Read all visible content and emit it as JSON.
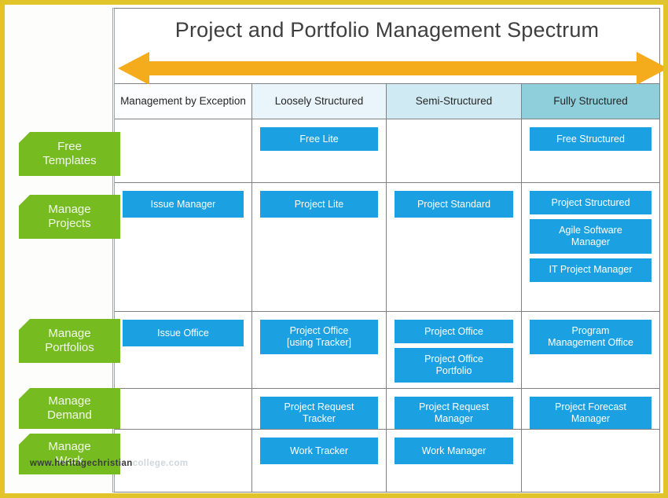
{
  "frame": {
    "border_color": "#e0c429"
  },
  "header": {
    "title": "Project and Portfolio Management Spectrum",
    "arrow": {
      "name": "double-headed-arrow",
      "color": "#f5ac1c",
      "direction": "both"
    }
  },
  "columns": [
    {
      "label": "Management by\nException",
      "bg": "#fbfdfe"
    },
    {
      "label": "Loosely Structured",
      "bg": "#e9f5fa"
    },
    {
      "label": "Semi-Structured",
      "bg": "#cfeaf2"
    },
    {
      "label": "Fully Structured",
      "bg": "#8ecfdb"
    }
  ],
  "row_labels": [
    {
      "label": "Free\nTemplates",
      "color": "#76bc21"
    },
    {
      "label": "Manage\nProjects",
      "color": "#76bc21"
    },
    {
      "label": "Manage\nPortfolios",
      "color": "#76bc21"
    },
    {
      "label": "Manage\nDemand",
      "color": "#76bc21"
    },
    {
      "label": "Manage\nWork",
      "color": "#76bc21"
    }
  ],
  "chip_color": "#1ba1e2",
  "rows": [
    {
      "name": "free-templates",
      "cells": [
        {
          "items": []
        },
        {
          "items": [
            "Free Lite"
          ]
        },
        {
          "items": []
        },
        {
          "items": [
            "Free Structured"
          ]
        }
      ]
    },
    {
      "name": "manage-projects",
      "cells": [
        {
          "items": [
            "Issue Manager"
          ]
        },
        {
          "items": [
            "Project Lite"
          ]
        },
        {
          "items": [
            "Project Standard"
          ]
        },
        {
          "items": [
            "Project Structured",
            "Agile Software\nManager",
            "IT Project Manager"
          ]
        }
      ]
    },
    {
      "name": "manage-portfolios",
      "cells": [
        {
          "items": [
            "Issue Office"
          ]
        },
        {
          "items": [
            "Project Office\n[using Tracker]"
          ]
        },
        {
          "items": [
            "Project Office",
            "Project Office\nPortfolio"
          ]
        },
        {
          "items": [
            "Program\nManagement Office"
          ]
        }
      ]
    },
    {
      "name": "manage-demand",
      "cells": [
        {
          "items": []
        },
        {
          "items": [
            "Project Request\nTracker"
          ]
        },
        {
          "items": [
            "Project Request\nManager"
          ]
        },
        {
          "items": [
            "Project Forecast\nManager"
          ]
        }
      ]
    },
    {
      "name": "manage-work",
      "cells": [
        {
          "items": []
        },
        {
          "items": [
            "Work Tracker"
          ]
        },
        {
          "items": [
            "Work Manager"
          ]
        },
        {
          "items": []
        }
      ]
    }
  ],
  "watermark": {
    "prefix": "www.",
    "mid": "heritagechristian",
    "suffix": "college.com"
  }
}
